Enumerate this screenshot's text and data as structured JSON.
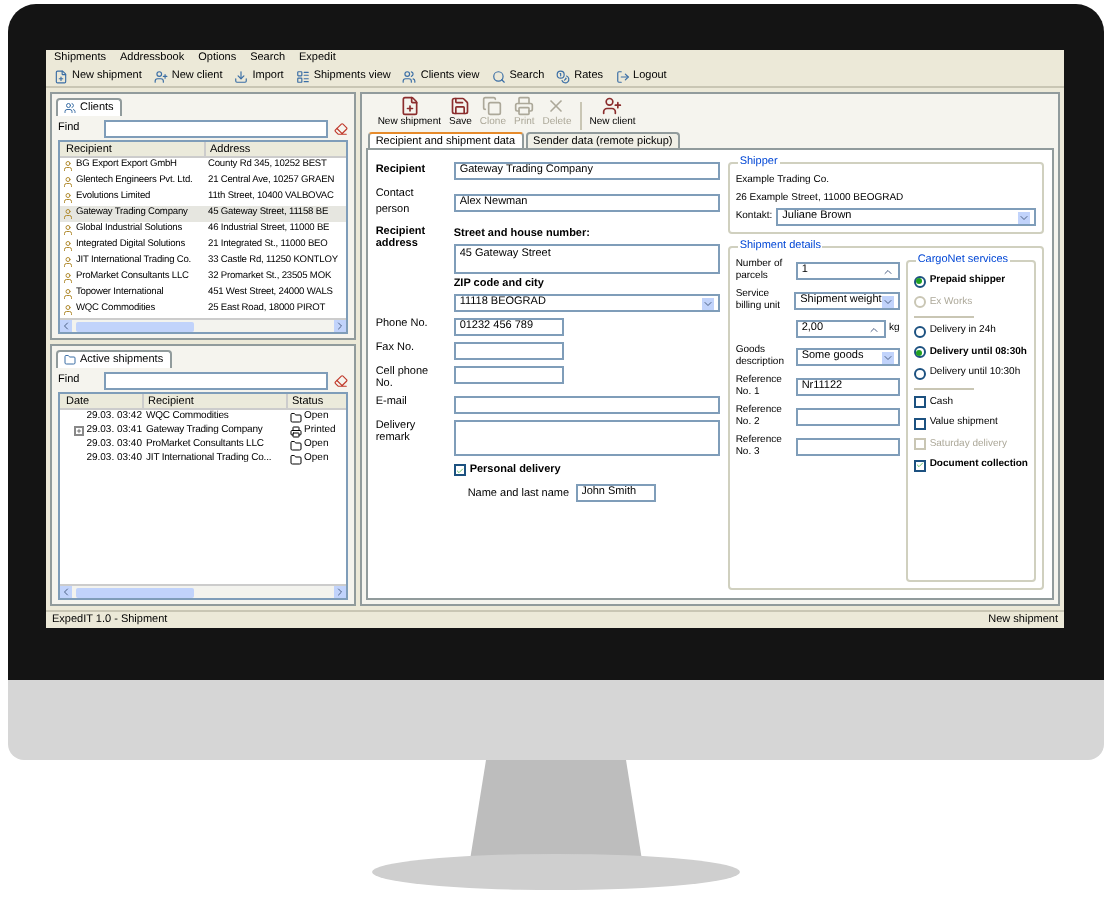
{
  "menu": [
    "Shipments",
    "Addressbook",
    "Options",
    "Search",
    "Expedit"
  ],
  "toolbar": [
    {
      "label": "New shipment",
      "kind": "new"
    },
    {
      "label": "New client",
      "kind": "client"
    },
    {
      "label": "Import",
      "kind": "import"
    },
    {
      "label": "Shipments view",
      "kind": "list"
    },
    {
      "label": "Clients view",
      "kind": "clients"
    },
    {
      "label": "Search",
      "kind": "search"
    },
    {
      "label": "Rates",
      "kind": "rates"
    },
    {
      "label": "Logout",
      "kind": "logout"
    }
  ],
  "clients": {
    "tab": "Clients",
    "find_label": "Find",
    "columns": [
      "Recipient",
      "Address"
    ],
    "rows": [
      {
        "name": "BG Export Export GmbH",
        "address": "County Rd 345, 10252 BEST",
        "selected": false
      },
      {
        "name": "Glentech Engineers Pvt. Ltd.",
        "address": "21 Central Ave, 10257 GRAEN",
        "selected": false
      },
      {
        "name": "Evolutions Limited",
        "address": "11th Street, 10400 VALBOVAC",
        "selected": false
      },
      {
        "name": "Gateway Trading Company",
        "address": "45 Gateway Street, 11158 BE",
        "selected": true
      },
      {
        "name": "Global Industrial Solutions",
        "address": "46 Industrial Street, 11000 BE",
        "selected": false
      },
      {
        "name": "Integrated Digital Solutions",
        "address": "21 Integrated St., 11000 BEO",
        "selected": false
      },
      {
        "name": "JIT International Trading Co.",
        "address": "33 Castle Rd, 11250 KONTLOY",
        "selected": false
      },
      {
        "name": "ProMarket Consultants LLC",
        "address": "32 Promarket St., 23505 MOK",
        "selected": false
      },
      {
        "name": "Topower International",
        "address": "451 West Street, 24000 WALS",
        "selected": false
      },
      {
        "name": "WQC Commodities",
        "address": "25 East Road, 18000 PIROT",
        "selected": false
      }
    ]
  },
  "active_shipments": {
    "tab": "Active shipments",
    "find_label": "Find",
    "columns": [
      "Date",
      "Recipient",
      "Status"
    ],
    "rows": [
      {
        "date": "29.03. 03:42",
        "recipient": "WQC Commodities",
        "status": "Open",
        "kind": "open",
        "expandable": false
      },
      {
        "date": "29.03. 03:41",
        "recipient": "Gateway Trading Company",
        "status": "Printed",
        "kind": "printed",
        "expandable": true
      },
      {
        "date": "29.03. 03:40",
        "recipient": "ProMarket Consultants LLC",
        "status": "Open",
        "kind": "open",
        "expandable": false
      },
      {
        "date": "29.03. 03:40",
        "recipient": "JIT International Trading Co...",
        "status": "Open",
        "kind": "open",
        "expandable": false
      }
    ]
  },
  "actions": [
    {
      "label": "New shipment",
      "kind": "new",
      "disabled": false
    },
    {
      "label": "Save",
      "kind": "save",
      "disabled": false
    },
    {
      "label": "Clone",
      "kind": "clone",
      "disabled": true
    },
    {
      "label": "Print",
      "kind": "print",
      "disabled": true
    },
    {
      "label": "Delete",
      "kind": "delete",
      "disabled": true
    },
    {
      "label": "New client",
      "kind": "client",
      "disabled": false
    }
  ],
  "tabs": [
    {
      "label": "Recipient and shipment data",
      "selected": true
    },
    {
      "label": "Sender data (remote pickup)",
      "selected": false
    }
  ],
  "recipient": {
    "label": "Recipient",
    "value": "Gateway Trading Company"
  },
  "contact": {
    "label": "Contact person",
    "value": "Alex Newman"
  },
  "address": {
    "label": "Recipient address",
    "street_label": "Street and house number:",
    "street": "45 Gateway Street",
    "zip_label": "ZIP code and city",
    "zip": "11118 BEOGRAD"
  },
  "contact_fields": [
    {
      "label": "Phone No.",
      "value": "01232 456 789",
      "kind": "short"
    },
    {
      "label": "Fax No.",
      "kind": "short"
    },
    {
      "label": "Cell phone No.",
      "kind": "short"
    },
    {
      "label": "E-mail",
      "kind": "wide"
    },
    {
      "label": "Delivery remark",
      "kind": "area"
    }
  ],
  "personal_delivery": {
    "label": "Personal delivery",
    "checked": true,
    "name_label": "Name and last name",
    "name": "John Smith"
  },
  "shipper": {
    "legend": "Shipper",
    "name": "Example Trading Co.",
    "address": "26 Example Street, 11000 BEOGRAD",
    "contact_label": "Kontakt:",
    "contact": "Juliane Brown"
  },
  "details": {
    "legend": "Shipment details",
    "fields": [
      {
        "label": "Number of parcels",
        "value": "1",
        "kind": "spin"
      },
      {
        "label": "Service billing unit",
        "value": "Shipment weight",
        "kind": "select"
      },
      {
        "value": "2,00",
        "unit": "kg",
        "kind": "weight"
      },
      {
        "label": "Goods description",
        "value": "Some goods",
        "kind": "select"
      },
      {
        "label": "Reference No. 1",
        "value": "Nr11122",
        "kind": "text"
      },
      {
        "label": "Reference No. 2",
        "kind": "text"
      },
      {
        "label": "Reference No. 3",
        "kind": "text"
      }
    ]
  },
  "services": {
    "legend": "CargoNet services",
    "items": [
      {
        "label": "Prepaid shipper",
        "kind": "radio",
        "selected": true,
        "disabled": false
      },
      {
        "label": "Ex Works",
        "kind": "radio",
        "selected": false,
        "disabled": true
      },
      {
        "kind": "divider"
      },
      {
        "label": "Delivery in 24h",
        "kind": "radio",
        "selected": false,
        "disabled": false
      },
      {
        "label": "Delivery until 08:30h",
        "kind": "radio",
        "selected": true,
        "disabled": false
      },
      {
        "label": "Delivery until 10:30h",
        "kind": "radio",
        "selected": false,
        "disabled": false
      },
      {
        "kind": "divider"
      },
      {
        "label": "Cash",
        "kind": "check",
        "checked": false,
        "disabled": false
      },
      {
        "label": "Value shipment",
        "kind": "check",
        "checked": false,
        "disabled": false
      },
      {
        "label": "Saturday delivery",
        "kind": "check",
        "checked": false,
        "disabled": true
      },
      {
        "label": "Document collection",
        "kind": "check",
        "checked": true,
        "disabled": false
      }
    ]
  },
  "status_bar": {
    "left": "ExpedIT 1.0 - Shipment",
    "right": "New shipment"
  }
}
